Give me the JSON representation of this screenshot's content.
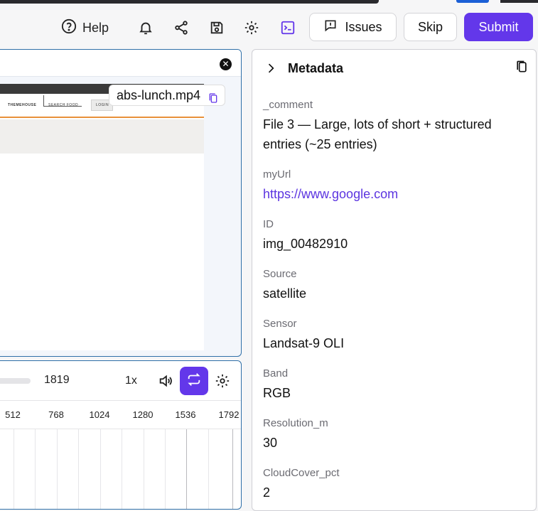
{
  "toolbar": {
    "help_label": "Help",
    "issues_label": "Issues",
    "skip_label": "Skip",
    "submit_label": "Submit"
  },
  "video": {
    "filename": "abs-lunch.mp4",
    "frame_nav_1": "THEMEHOUSE",
    "frame_nav_2": "SEARCH FOOD",
    "frame_nav_3": "LOGIN"
  },
  "player": {
    "duration": "1819",
    "speed": "1x",
    "ticks": [
      "512",
      "768",
      "1024",
      "1280",
      "1536",
      "1792"
    ]
  },
  "metadata": {
    "title": "Metadata",
    "entries": [
      {
        "key": "_comment",
        "value": "File 3 — Large, lots of short + structured entries (~25 entries)"
      },
      {
        "key": "myUrl",
        "value": "https://www.google.com"
      },
      {
        "key": "ID",
        "value": "img_00482910"
      },
      {
        "key": "Source",
        "value": "satellite"
      },
      {
        "key": "Sensor",
        "value": "Landsat-9 OLI"
      },
      {
        "key": "Band",
        "value": "RGB"
      },
      {
        "key": "Resolution_m",
        "value": "30"
      },
      {
        "key": "CloudCover_pct",
        "value": "2"
      }
    ]
  },
  "colors": {
    "accent": "#6337ea",
    "link": "#5b34e0",
    "panel_border": "#2f6fa8"
  }
}
